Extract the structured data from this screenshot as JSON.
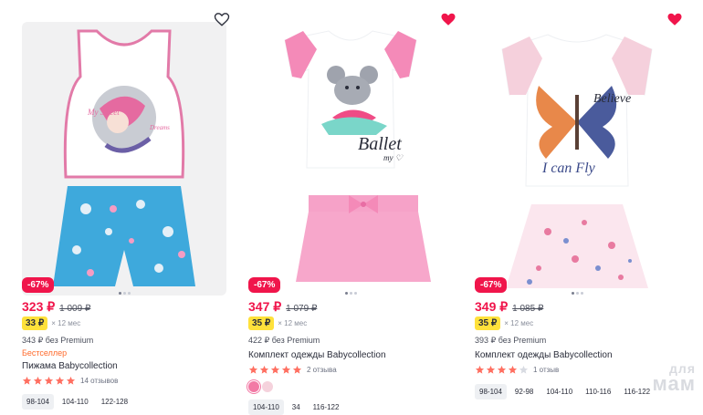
{
  "colors": {
    "accent": "#f0154b",
    "installment_bg": "#ffe13b",
    "star": "#ff6f61",
    "star_empty": "#d8dbe2",
    "bestseller": "#ff6a2b"
  },
  "watermark": {
    "line1": "для",
    "line2": "мам"
  },
  "products": [
    {
      "favorite": false,
      "image_alt": "Pajama: white tank top with girl on moon print and blue printed shorts",
      "discount": "-67%",
      "price": "323 ₽",
      "old_price": "1 009 ₽",
      "installment": "33 ₽",
      "installment_term": "× 12 мес",
      "premium_price": "343 ₽ без Premium",
      "badge": "Бестселлер",
      "title": "Пижама Babycollection",
      "rating": 5,
      "reviews": "14 отзывов",
      "sizes": [
        "98-104",
        "104-110",
        "122-128"
      ],
      "selected_size": 0
    },
    {
      "favorite": true,
      "image_alt": "Set: white t-shirt with ballet mouse print and pink skirt",
      "discount": "-67%",
      "price": "347 ₽",
      "old_price": "1 079 ₽",
      "installment": "35 ₽",
      "installment_term": "× 12 мес",
      "premium_price": "422 ₽ без Premium",
      "title": "Комплект одежды Babycollection",
      "rating": 5,
      "reviews": "2 отзыва",
      "swatches": [
        "#f27aa5",
        "#f5d2dc"
      ],
      "sizes": [
        "104-110",
        "34",
        "116-122"
      ],
      "selected_size": 0
    },
    {
      "favorite": true,
      "image_alt": "Set: white t-shirt with butterfly print and pink heart-pattern skirt",
      "discount": "-67%",
      "price": "349 ₽",
      "old_price": "1 085 ₽",
      "installment": "35 ₽",
      "installment_term": "× 12 мес",
      "premium_price": "393 ₽ без Premium",
      "title": "Комплект одежды Babycollection",
      "rating": 4,
      "reviews": "1 отзыв",
      "sizes": [
        "98-104",
        "92-98",
        "104-110",
        "110-116",
        "116-122"
      ],
      "selected_size": 0
    }
  ]
}
